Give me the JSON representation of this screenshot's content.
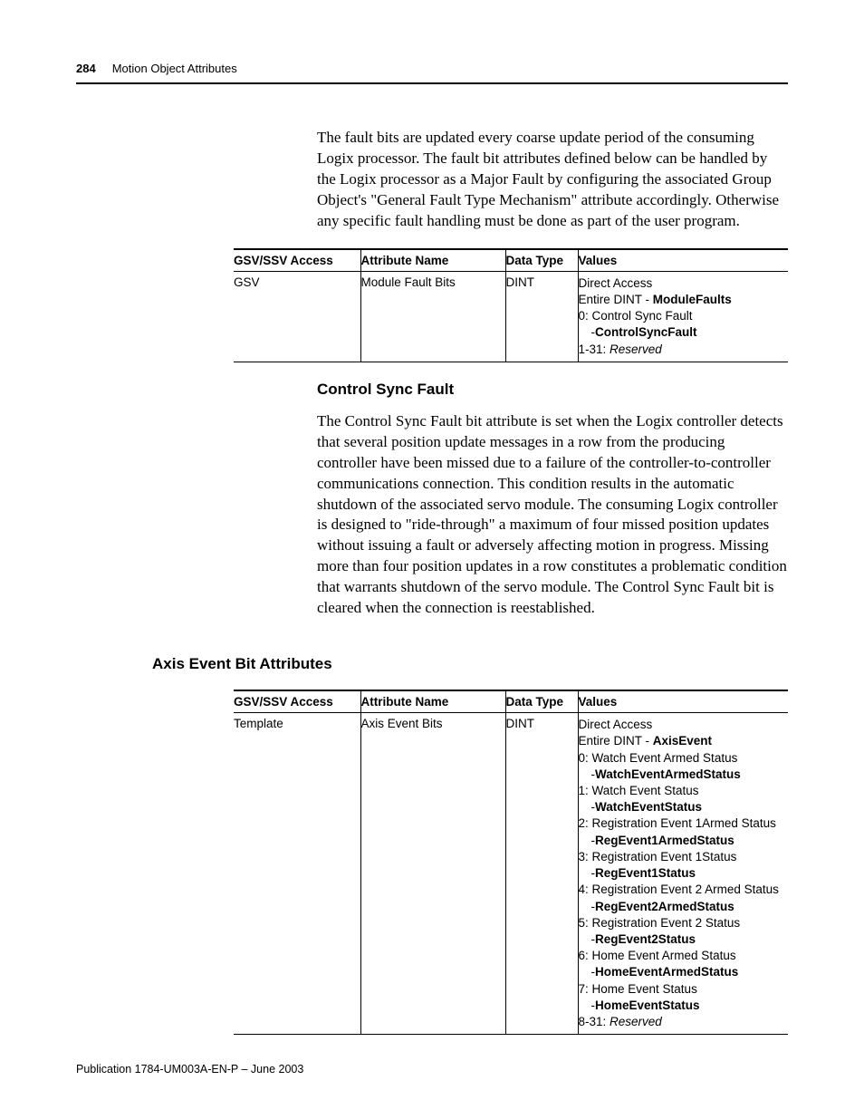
{
  "header": {
    "page_num": "284",
    "chapter": "Motion Object Attributes"
  },
  "intro_para": "The fault bits are updated every coarse update period of the consuming Logix processor. The fault bit attributes defined below can be handled by the Logix processor as a Major Fault by configuring the associated Group Object's \"General Fault Type Mechanism\" attribute accordingly. Otherwise any specific fault handling must be done as part of the user program.",
  "table1": {
    "headers": {
      "c1": "GSV/SSV Access",
      "c2": "Attribute Name",
      "c3": "Data Type",
      "c4": "Values"
    },
    "row": {
      "access": "GSV",
      "name": "Module Fault Bits",
      "type": "DINT",
      "values": {
        "l1": "Direct Access",
        "l2a": "Entire DINT - ",
        "l2b": "ModuleFaults",
        "l3": "0: Control Sync Fault",
        "l4a": "-",
        "l4b": "ControlSyncFault",
        "l5a": "1-31: ",
        "l5b": "Reserved"
      }
    }
  },
  "subheading1": "Control Sync Fault",
  "para2": "The Control Sync Fault bit attribute is set when the Logix controller detects that several position update messages in a row from the producing controller have been missed due to a failure of the controller-to-controller communications connection. This condition results in the automatic shutdown of the associated servo module. The consuming Logix controller is designed to \"ride-through\" a maximum of four missed position updates without issuing a fault or adversely affecting motion in progress. Missing more than four position updates in a row constitutes a problematic condition that warrants shutdown of the servo module. The Control Sync Fault bit is cleared when the connection is reestablished.",
  "section2": "Axis Event Bit Attributes",
  "table2": {
    "headers": {
      "c1": "GSV/SSV Access",
      "c2": "Attribute Name",
      "c3": "Data Type",
      "c4": "Values"
    },
    "row": {
      "access": "Template",
      "name": "Axis Event Bits",
      "type": "DINT",
      "values": {
        "l1": "Direct Access",
        "l2a": "Entire DINT - ",
        "l2b": "AxisEvent",
        "b0": "0: Watch Event Armed Status",
        "b0t": "WatchEventArmedStatus",
        "b1": "1: Watch Event Status",
        "b1t": "WatchEventStatus",
        "b2": "2: Registration Event 1Armed Status",
        "b2t": "RegEvent1ArmedStatus",
        "b3": "3: Registration Event 1Status",
        "b3t": "RegEvent1Status",
        "b4": "4: Registration Event 2 Armed Status",
        "b4t": "RegEvent2ArmedStatus",
        "b5": "5: Registration Event 2 Status",
        "b5t": "RegEvent2Status",
        "b6": "6: Home Event Armed Status",
        "b6t": "HomeEventArmedStatus",
        "b7": "7: Home Event Status",
        "b7t": "HomeEventStatus",
        "res_a": "8-31: ",
        "res_b": "Reserved"
      }
    }
  },
  "footer": "Publication 1784-UM003A-EN-P – June 2003"
}
